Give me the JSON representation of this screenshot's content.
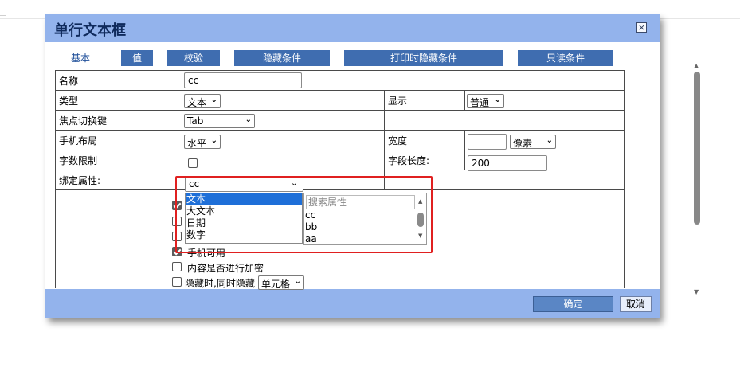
{
  "dialog": {
    "title": "单行文本框",
    "close_symbol": "×"
  },
  "tabs": [
    {
      "label": "基本"
    },
    {
      "label": "值"
    },
    {
      "label": "校验"
    },
    {
      "label": "隐藏条件"
    },
    {
      "label": "打印时隐藏条件"
    },
    {
      "label": "只读条件"
    }
  ],
  "form": {
    "name_label": "名称",
    "name_value": "cc",
    "type_label": "类型",
    "type_value": "文本",
    "display_label": "显示",
    "display_value": "普通",
    "focus_label": "焦点切换键",
    "focus_value": "Tab",
    "mobile_layout_label": "手机布局",
    "mobile_layout_value": "水平",
    "width_label": "宽度",
    "width_value": "",
    "width_unit": "像素",
    "char_limit_label": "字数限制",
    "field_length_label": "字段长度:",
    "field_length_value": "200",
    "bind_label": "绑定属性:",
    "bind_value": "cc"
  },
  "type_dropdown": {
    "options": [
      "文本",
      "大文本",
      "日期",
      "数字"
    ]
  },
  "property_panel": {
    "search_placeholder": "搜索属性",
    "items": [
      "cc",
      "bb",
      "aa"
    ]
  },
  "options": {
    "mobile_available_label": "手机可用",
    "encrypt_label": "内容是否进行加密",
    "hide_together_label": "隐藏时,同时隐藏",
    "hide_together_select": "单元格"
  },
  "footer": {
    "ok_label": "确定",
    "cancel_label": "取消"
  },
  "colors": {
    "title_bar": "#93b3ec",
    "tab_blue": "#3f6db0",
    "highlight": "#e02020",
    "dropdown_selected": "#1e6fd8"
  },
  "icons": [
    "close-icon",
    "chevron-down-icon",
    "checkbox-checked-icon",
    "scroll-up-arrow-icon",
    "scroll-down-arrow-icon"
  ]
}
